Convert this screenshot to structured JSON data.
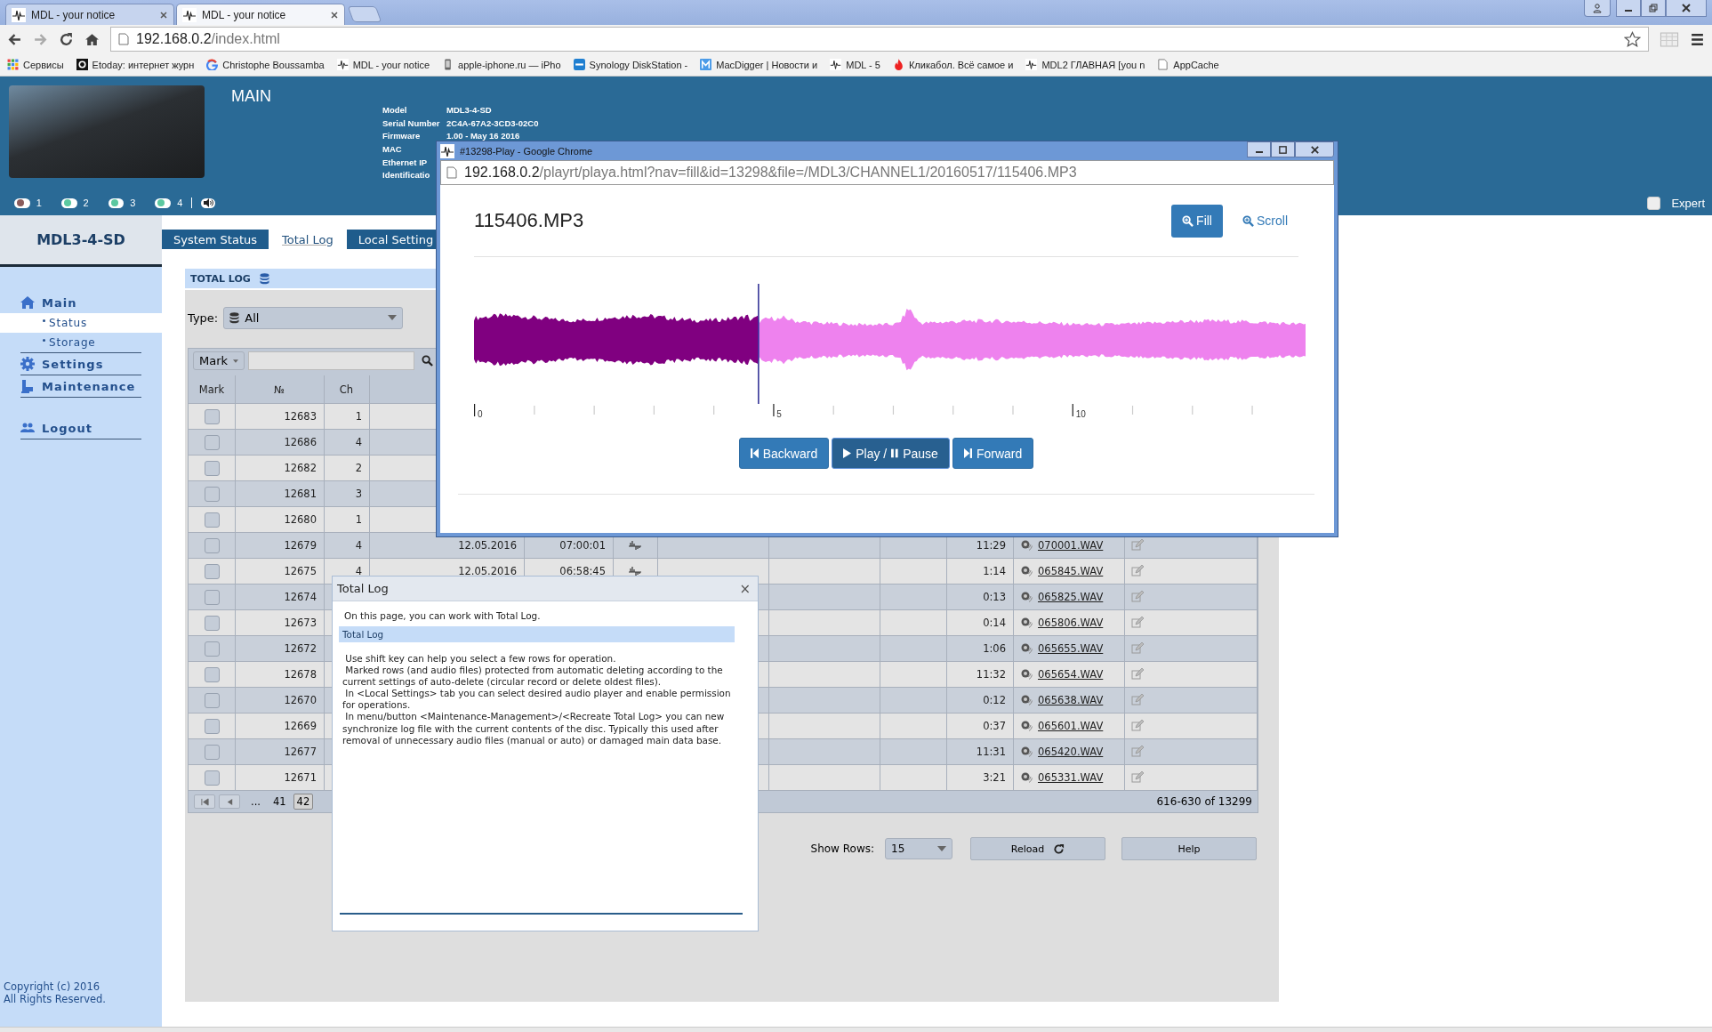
{
  "browser": {
    "tabs": [
      {
        "title": "MDL - your notice",
        "selected": false
      },
      {
        "title": "MDL - your notice",
        "selected": true
      }
    ],
    "address": {
      "host": "192.168.0.2",
      "path": "/index.html"
    },
    "bookmarks": [
      {
        "label": "Сервисы",
        "kind": "apps"
      },
      {
        "label": "Etoday: интернет журн",
        "kind": "letter"
      },
      {
        "label": "Christophe Boussamba",
        "kind": "google"
      },
      {
        "label": "MDL - your notice",
        "kind": "wave"
      },
      {
        "label": "apple-iphone.ru — iPho",
        "kind": "phone"
      },
      {
        "label": "Synology DiskStation -",
        "kind": "dsm"
      },
      {
        "label": "MacDigger | Новости и",
        "kind": "square"
      },
      {
        "label": "MDL - 5",
        "kind": "wave"
      },
      {
        "label": "Кликабол. Всё самое и",
        "kind": "flame"
      },
      {
        "label": "MDL2 ГЛАВНАЯ [you n",
        "kind": "wave"
      },
      {
        "label": "AppCache",
        "kind": "page"
      }
    ]
  },
  "header": {
    "title": "MAIN",
    "device_info": [
      {
        "label": "Model",
        "value": "MDL3-4-SD"
      },
      {
        "label": "Serial Number",
        "value": "2C4A-67A2-3CD3-02C0"
      },
      {
        "label": "Firmware",
        "value": "1.00 - May 16 2016"
      },
      {
        "label": "MAC"
      },
      {
        "label": "Ethernet IP"
      },
      {
        "label": "Identificatio"
      }
    ],
    "channels": [
      {
        "label": "1",
        "color": "#8a5c5c"
      },
      {
        "label": "2",
        "color": "#5cc8a0"
      },
      {
        "label": "3",
        "color": "#5cc8a0"
      },
      {
        "label": "4",
        "color": "#5cc8a0"
      }
    ],
    "speaker": {
      "on": true
    },
    "expert": {
      "label": "Expert",
      "checked": false
    }
  },
  "sidebar": {
    "device": "MDL3-4-SD",
    "items": [
      {
        "label": "Main",
        "kind": "home",
        "selected": false,
        "children": [
          {
            "label": "Status",
            "selected": true
          },
          {
            "label": "Storage",
            "selected": false
          }
        ]
      },
      {
        "label": "Settings",
        "kind": "gear",
        "selected": false
      },
      {
        "label": "Maintenance",
        "kind": "tool",
        "selected": false
      },
      {
        "label": "Logout",
        "kind": "users",
        "selected": false
      }
    ],
    "copyright": [
      "Copyright (c) 2016",
      "All Rights Reserved."
    ]
  },
  "tabs": [
    {
      "label": "System Status",
      "selected": false
    },
    {
      "label": "Total Log",
      "selected": true
    },
    {
      "label": "Local Setting",
      "selected": false
    }
  ],
  "section_title": "TOTAL LOG",
  "type_filter": {
    "label": "Type:",
    "value": "All"
  },
  "mark_filter": {
    "value": "Mark"
  },
  "table": {
    "columns": [
      "Mark",
      "№",
      "Ch"
    ],
    "rows": [
      {
        "checked": false,
        "number": "12683",
        "ch": "1"
      },
      {
        "checked": false,
        "number": "12686",
        "ch": "4"
      },
      {
        "checked": false,
        "number": "12682",
        "ch": "2"
      },
      {
        "checked": false,
        "number": "12681",
        "ch": "3"
      },
      {
        "checked": false,
        "number": "12680",
        "ch": "1"
      },
      {
        "checked": false,
        "number": "12679",
        "ch": "4",
        "date": "12.05.2016",
        "time": "07:00:01",
        "duration": "11:29",
        "file": "070001.WAV"
      },
      {
        "checked": false,
        "number": "12675",
        "ch": "4",
        "date": "12.05.2016",
        "time": "06:58:45",
        "duration": "1:14",
        "file": "065845.WAV"
      },
      {
        "checked": false,
        "number": "12674",
        "duration": "0:13",
        "file": "065825.WAV"
      },
      {
        "checked": false,
        "number": "12673",
        "duration": "0:14",
        "file": "065806.WAV"
      },
      {
        "checked": false,
        "number": "12672",
        "duration": "1:06",
        "file": "065655.WAV"
      },
      {
        "checked": false,
        "number": "12678",
        "duration": "11:32",
        "file": "065654.WAV"
      },
      {
        "checked": false,
        "number": "12670",
        "duration": "0:12",
        "file": "065638.WAV"
      },
      {
        "checked": false,
        "number": "12669",
        "duration": "0:37",
        "file": "065601.WAV"
      },
      {
        "checked": false,
        "number": "12677",
        "duration": "11:31",
        "file": "065420.WAV"
      },
      {
        "checked": false,
        "number": "12671",
        "duration": "3:21",
        "file": "065331.WAV"
      }
    ]
  },
  "pager": {
    "ellipsis": "...",
    "pages": [
      {
        "label": "41",
        "selected": false
      },
      {
        "label": "42",
        "selected": true
      }
    ],
    "range": "616-630 of 13299"
  },
  "footer": {
    "show_rows_label": "Show Rows:",
    "show_rows_value": "15",
    "reload": "Reload",
    "help": "Help"
  },
  "player": {
    "window_title": "#13298-Play - Google Chrome",
    "address": {
      "host": "192.168.0.2",
      "path": "/playrt/playa.html?nav=fill&id=13298&file=/MDL3/CHANNEL1/20160517/115406.MP3"
    },
    "file_title": "115406.MP3",
    "zoom_modes": [
      {
        "label": "Fill",
        "selected": true
      },
      {
        "label": "Scroll",
        "selected": false
      }
    ],
    "progress": {
      "level": 0.342
    },
    "timeline_labels": [
      "0",
      "5",
      "10"
    ],
    "controls": [
      {
        "kind": "backward",
        "label": "Backward",
        "selected": false
      },
      {
        "kind": "playpause",
        "label": "Play /",
        "label_2": "Pause",
        "selected": true
      },
      {
        "kind": "forward",
        "label": "Forward",
        "selected": false
      }
    ]
  },
  "help": {
    "title": "Total Log",
    "close": "×",
    "intro": "On this page, you can work with Total Log.",
    "section": "Total Log",
    "paragraphs": [
      " Use shift key can help you select a few rows for operation.",
      " Marked rows (and audio files) protected from automatic deleting according to the current settings of auto-delete (circular record or delete oldest files).",
      " In <Local Settings> tab you can select desired audio player and enable permission for operations.",
      " In menu/button <Maintenance-Management>/<Recreate Total Log> you can new synchronize log file with the current contents of the disc. Typically this used after removal of unnecessary audio files (manual or auto) or damaged main data base."
    ]
  }
}
